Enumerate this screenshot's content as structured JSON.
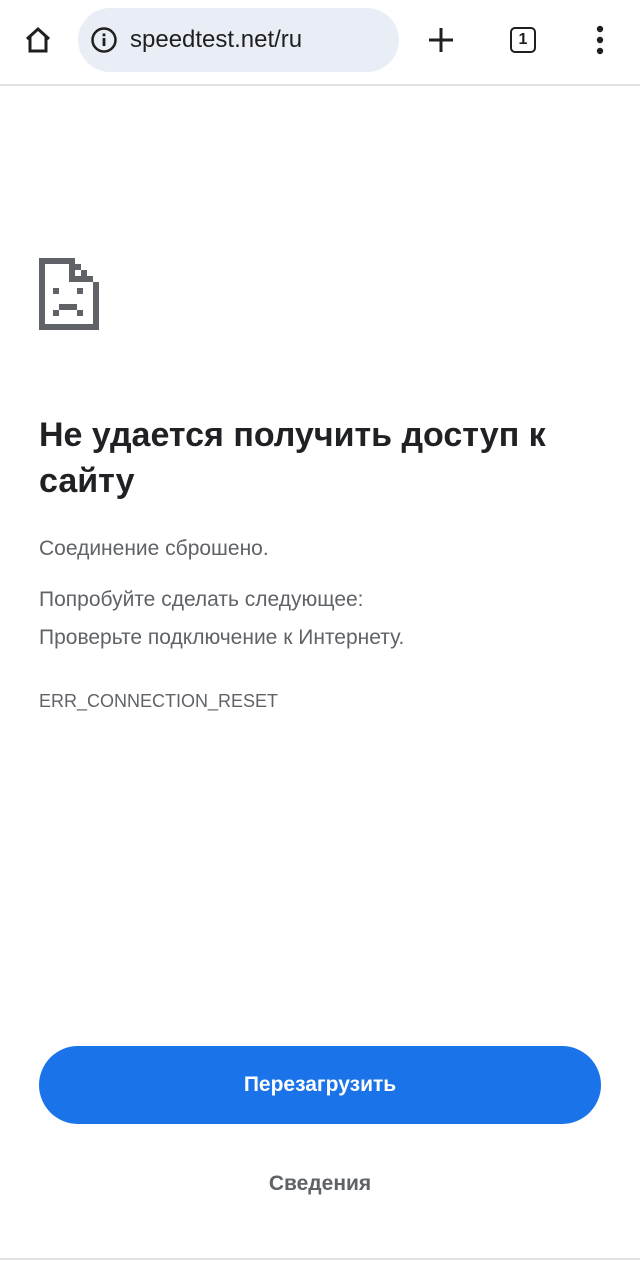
{
  "browser": {
    "url": "speedtest.net/ru",
    "tab_count": "1",
    "icons": {
      "home": "home-icon",
      "site_info": "info-icon",
      "new_tab": "plus-icon",
      "tabs": "tab-switcher-icon",
      "menu": "more-vert-icon"
    }
  },
  "error": {
    "icon": "sad-page-icon",
    "title": "Не удается получить доступ к сайту",
    "message": "Соединение сброшено.",
    "suggestion_heading": "Попробуйте сделать следующее:",
    "suggestion": "Проверьте подключение к Интернету.",
    "code": "ERR_CONNECTION_RESET"
  },
  "actions": {
    "reload_label": "Перезагрузить",
    "details_label": "Сведения"
  },
  "colors": {
    "accent": "#1a73e8",
    "omnibox_bg": "#e9eef6",
    "title_text": "#202124",
    "secondary_text": "#5f6368"
  }
}
